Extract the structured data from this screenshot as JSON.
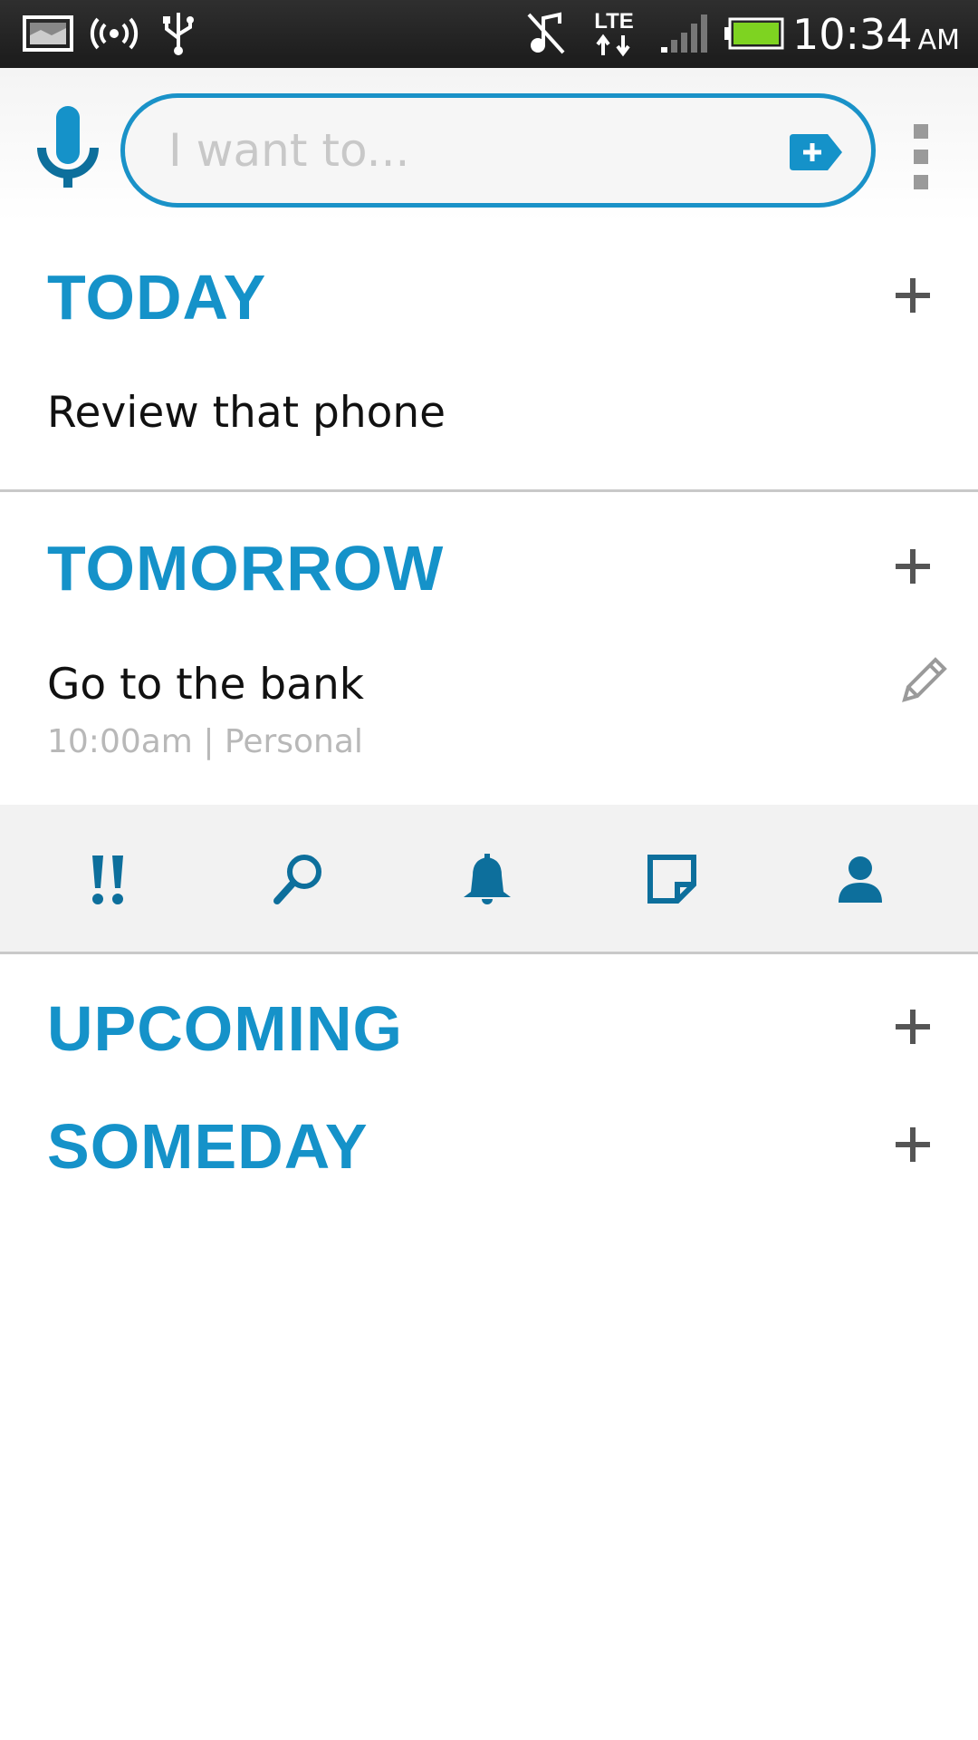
{
  "status_bar": {
    "time": "10:34",
    "ampm": "AM",
    "network": "LTE",
    "icons": [
      "gallery-icon",
      "wireless-broadcast-icon",
      "usb-icon",
      "music-muted-icon",
      "lte-data-icon",
      "signal-icon",
      "battery-icon"
    ]
  },
  "search": {
    "placeholder": "I want to..."
  },
  "sections": {
    "today": {
      "title": "TODAY",
      "tasks": [
        {
          "title": "Review that phone"
        }
      ]
    },
    "tomorrow": {
      "title": "TOMORROW",
      "tasks": [
        {
          "title": "Go to the bank",
          "meta": "10:00am | Personal"
        }
      ]
    },
    "upcoming": {
      "title": "UPCOMING"
    },
    "someday": {
      "title": "SOMEDAY"
    }
  },
  "toolbar": {
    "tools": [
      "priority-icon",
      "search-icon",
      "reminder-bell-icon",
      "note-icon",
      "contact-icon"
    ]
  },
  "colors": {
    "accent": "#1592c9",
    "toolbar_icon": "#0d78aa",
    "status_bg": "#222222",
    "battery": "#7ed321"
  }
}
